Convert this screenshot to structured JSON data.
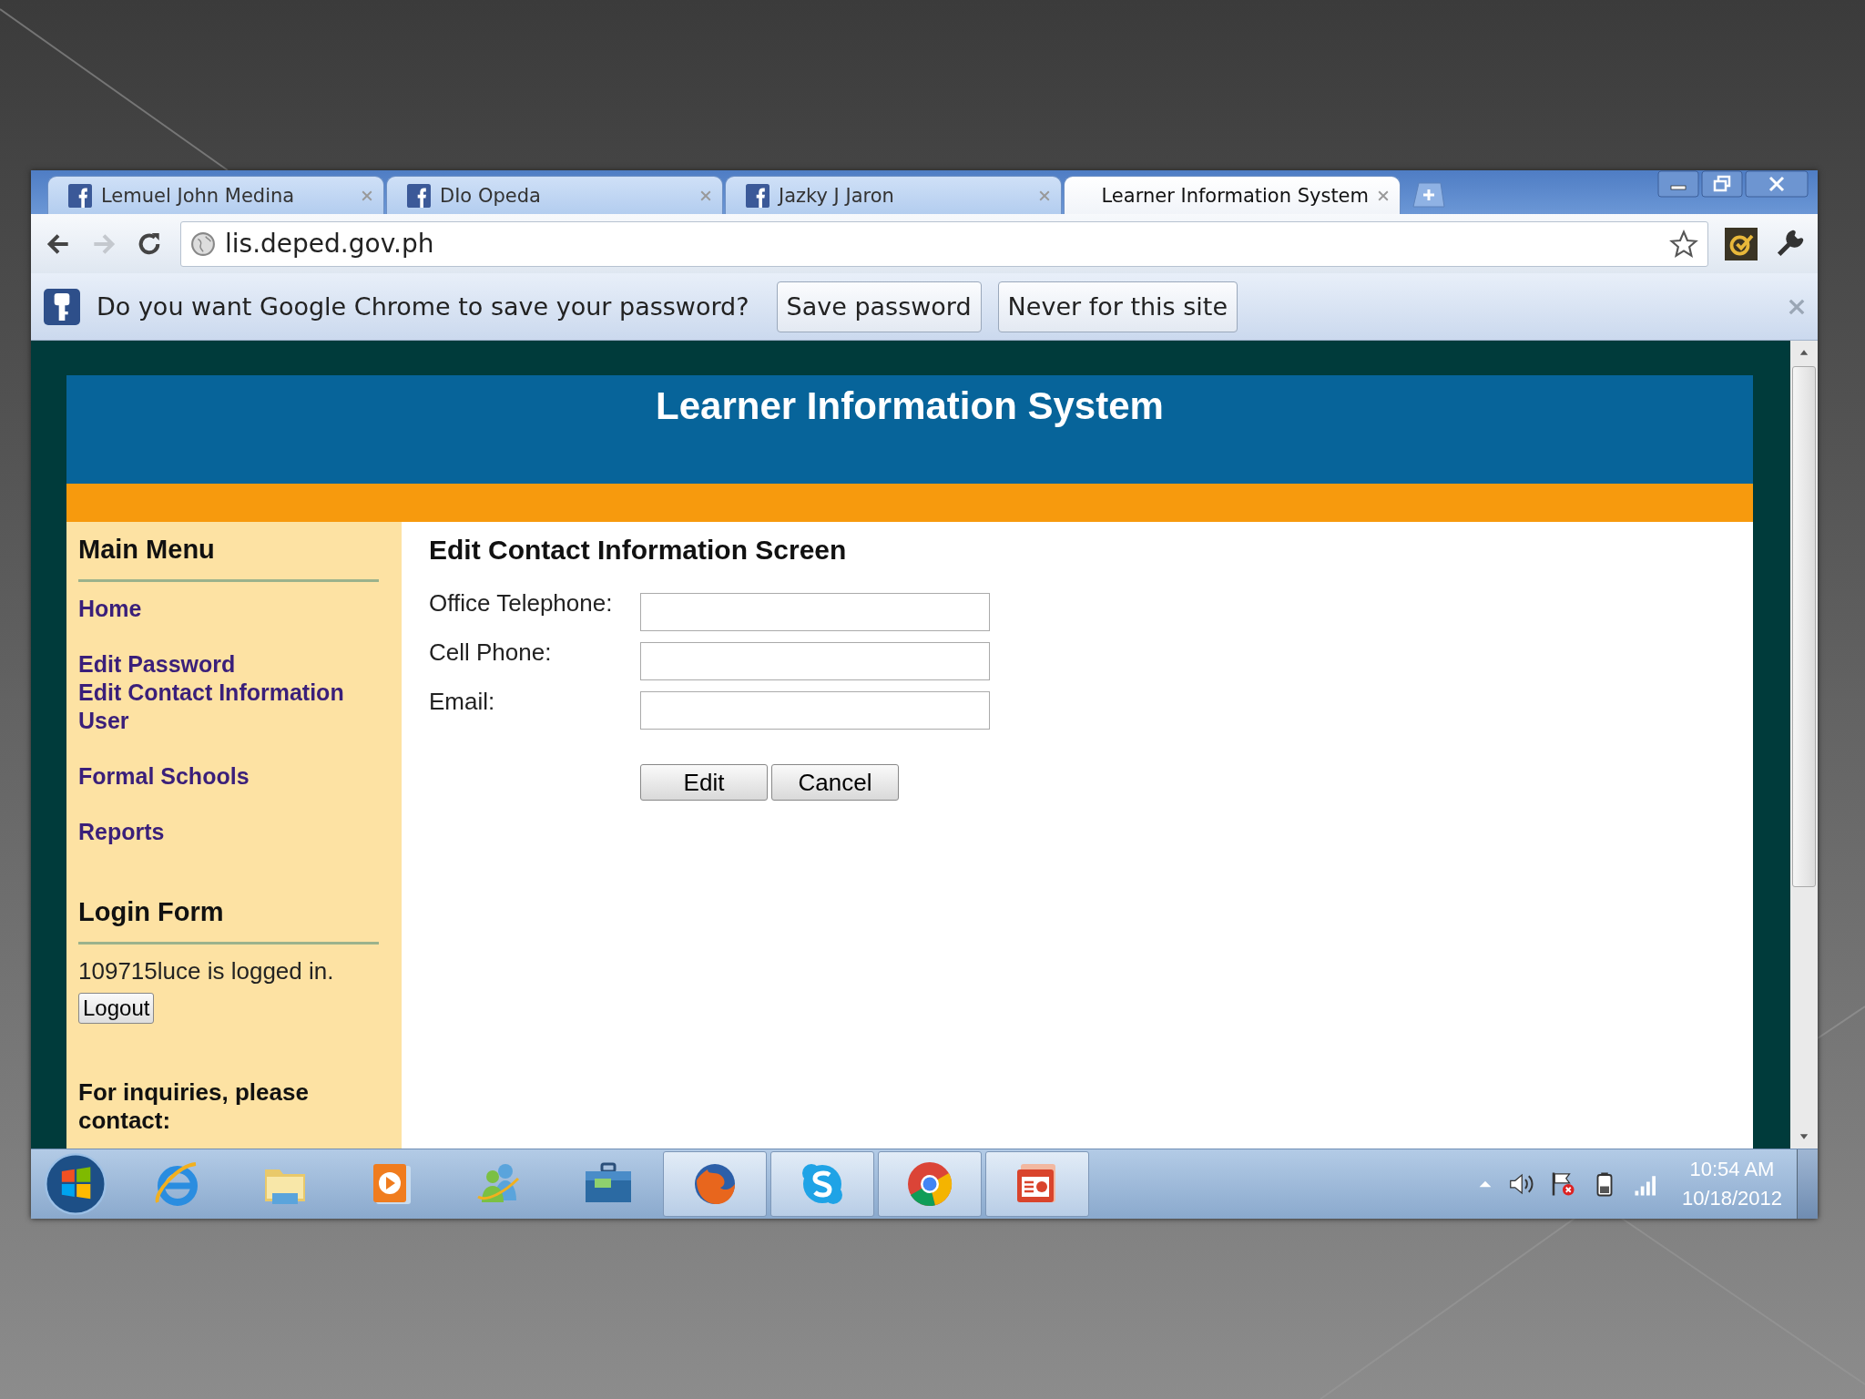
{
  "browser": {
    "tabs": [
      {
        "title": "Lemuel John Medina",
        "kind": "facebook",
        "selected": false
      },
      {
        "title": "DIo Opeda",
        "kind": "facebook",
        "selected": false
      },
      {
        "title": "Jazky J Jaron",
        "kind": "facebook",
        "selected": false
      },
      {
        "title": "Learner Information System",
        "kind": "page",
        "selected": true
      }
    ],
    "address": "lis.deped.gov.ph",
    "infobar": {
      "message": "Do you want Google Chrome to save your password?",
      "buttons": [
        "Save password",
        "Never for this site"
      ]
    }
  },
  "page": {
    "header": "Learner Information System",
    "sidebar": {
      "menu_title": "Main Menu",
      "link_groups": [
        {
          "links": [
            "Home"
          ]
        },
        {
          "links": [
            "Edit Password",
            "Edit Contact Information",
            "User"
          ]
        },
        {
          "links": [
            "Formal Schools"
          ]
        },
        {
          "links": [
            "Reports"
          ]
        }
      ],
      "login_title": "Login Form",
      "login_status": "109715luce is logged in.",
      "logout_button": "Logout",
      "inquiries": "For inquiries, please contact:"
    },
    "form": {
      "title": "Edit Contact Information Screen",
      "fields": [
        {
          "label": "Office Telephone:"
        },
        {
          "label": "Cell Phone:"
        },
        {
          "label": "Email:"
        }
      ],
      "buttons": [
        "Edit",
        "Cancel"
      ]
    }
  },
  "taskbar": {
    "apps": [
      {
        "kind": "ie",
        "running": false
      },
      {
        "kind": "folder",
        "running": false
      },
      {
        "kind": "media",
        "running": false
      },
      {
        "kind": "people",
        "running": false
      },
      {
        "kind": "briefcase",
        "running": false
      },
      {
        "kind": "firefox",
        "running": true
      },
      {
        "kind": "skype",
        "running": true
      },
      {
        "kind": "chrome",
        "running": true
      },
      {
        "kind": "slides",
        "running": true
      }
    ],
    "time": "10:54 AM",
    "date": "10/18/2012"
  }
}
